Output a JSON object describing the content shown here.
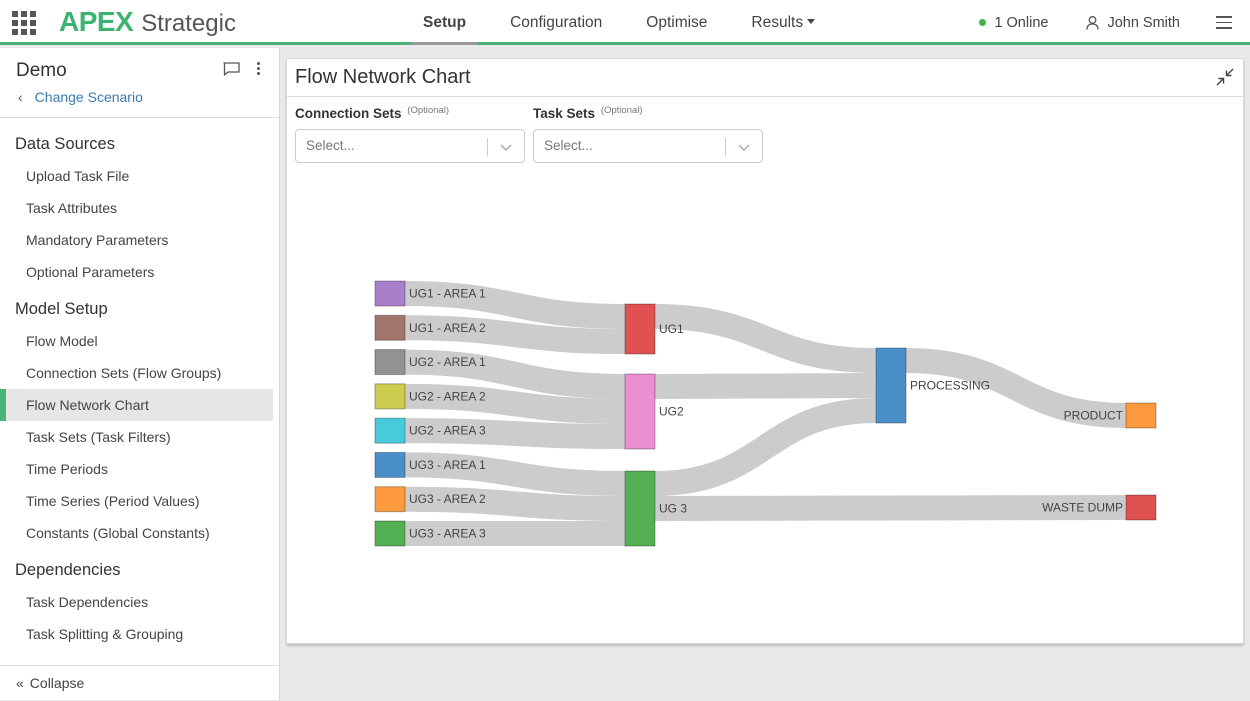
{
  "app": {
    "brand_bold": "APEX",
    "brand_light": "Strategic"
  },
  "nav": {
    "items": [
      {
        "label": "Setup",
        "active": true
      },
      {
        "label": "Configuration",
        "active": false
      },
      {
        "label": "Optimise",
        "active": false
      },
      {
        "label": "Results",
        "active": false,
        "dropdown": true
      }
    ]
  },
  "status": {
    "online_text": "1 Online",
    "online_color": "#3db83d",
    "user_name": "John Smith"
  },
  "sidebar": {
    "scenario_name": "Demo",
    "change_scenario": "Change Scenario",
    "sections": [
      {
        "title": "Data Sources",
        "items": [
          "Upload Task File",
          "Task Attributes",
          "Mandatory Parameters",
          "Optional Parameters"
        ]
      },
      {
        "title": "Model Setup",
        "items": [
          "Flow Model",
          "Connection Sets (Flow Groups)",
          "Flow Network Chart",
          "Task Sets (Task Filters)",
          "Time Periods",
          "Time Series (Period Values)",
          "Constants (Global Constants)"
        ]
      },
      {
        "title": "Dependencies",
        "items": [
          "Task Dependencies",
          "Task Splitting & Grouping"
        ]
      }
    ],
    "active_item": "Flow Network Chart",
    "collapse_label": "Collapse"
  },
  "panel": {
    "title": "Flow Network Chart",
    "filters": [
      {
        "label": "Connection Sets",
        "optional": "(Optional)",
        "placeholder": "Select..."
      },
      {
        "label": "Task Sets",
        "optional": "(Optional)",
        "placeholder": "Select..."
      }
    ]
  },
  "colors": {
    "accent": "#4cb176",
    "link": "#cccccc"
  },
  "chart_data": {
    "type": "sankey",
    "title": "",
    "nodes": [
      {
        "id": "UG1 - AREA 1",
        "column": 0,
        "color": "#a97fcc"
      },
      {
        "id": "UG1 - AREA 2",
        "column": 0,
        "color": "#a3766b"
      },
      {
        "id": "UG2 - AREA 1",
        "column": 0,
        "color": "#929292"
      },
      {
        "id": "UG2 - AREA 2",
        "column": 0,
        "color": "#cccc4e"
      },
      {
        "id": "UG2 - AREA 3",
        "column": 0,
        "color": "#45cbd9"
      },
      {
        "id": "UG3 - AREA 1",
        "column": 0,
        "color": "#4a8fc7"
      },
      {
        "id": "UG3 - AREA 2",
        "column": 0,
        "color": "#fe9a3e"
      },
      {
        "id": "UG3 - AREA 3",
        "column": 0,
        "color": "#53b153"
      },
      {
        "id": "UG1",
        "column": 1,
        "color": "#e05151"
      },
      {
        "id": "UG2",
        "column": 1,
        "color": "#ea8fcf"
      },
      {
        "id": "UG 3",
        "column": 1,
        "color": "#53b153"
      },
      {
        "id": "PROCESSING",
        "column": 2,
        "color": "#4a8fc7"
      },
      {
        "id": "PRODUCT",
        "column": 3,
        "color": "#fe9a3e"
      },
      {
        "id": "WASTE DUMP",
        "column": 3,
        "color": "#e05151"
      }
    ],
    "links": [
      {
        "source": "UG1 - AREA 1",
        "target": "UG1",
        "value": 1
      },
      {
        "source": "UG1 - AREA 2",
        "target": "UG1",
        "value": 1
      },
      {
        "source": "UG2 - AREA 1",
        "target": "UG2",
        "value": 1
      },
      {
        "source": "UG2 - AREA 2",
        "target": "UG2",
        "value": 1
      },
      {
        "source": "UG2 - AREA 3",
        "target": "UG2",
        "value": 1
      },
      {
        "source": "UG3 - AREA 1",
        "target": "UG 3",
        "value": 1
      },
      {
        "source": "UG3 - AREA 2",
        "target": "UG 3",
        "value": 1
      },
      {
        "source": "UG3 - AREA 3",
        "target": "UG 3",
        "value": 1
      },
      {
        "source": "UG1",
        "target": "PROCESSING",
        "value": 1
      },
      {
        "source": "UG2",
        "target": "PROCESSING",
        "value": 1
      },
      {
        "source": "UG 3",
        "target": "PROCESSING",
        "value": 1
      },
      {
        "source": "UG 3",
        "target": "WASTE DUMP",
        "value": 1
      },
      {
        "source": "PROCESSING",
        "target": "PRODUCT",
        "value": 1
      }
    ]
  }
}
